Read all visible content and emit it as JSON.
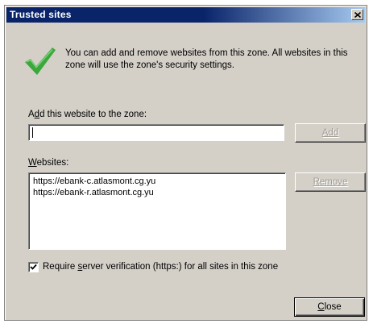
{
  "window": {
    "title": "Trusted sites",
    "close_glyph": "✕"
  },
  "info": {
    "icon": "check-icon",
    "text": "You can add and remove websites from this zone. All websites in this zone will use the zone's security settings."
  },
  "add_section": {
    "label_pre": "A",
    "label_mnemonic": "d",
    "label_post": "d this website to the zone:",
    "input_value": "",
    "add_button_label": "Add",
    "add_button_enabled": false
  },
  "websites_section": {
    "label_mnemonic": "W",
    "label_post": "ebsites:",
    "items": [
      "https://ebank-c.atlasmont.cg.yu",
      "https://ebank-r.atlasmont.cg.yu"
    ],
    "remove_button_label": "Remove",
    "remove_button_enabled": false
  },
  "verification": {
    "checked": true,
    "label_pre": "Require ",
    "label_mnemonic": "s",
    "label_post": "erver verification (https:) for all sites in this zone"
  },
  "footer": {
    "close_button_mnemonic": "C",
    "close_button_post": "lose"
  },
  "colors": {
    "dialog_face": "#d4d0c8",
    "titlebar_start": "#0a246a",
    "titlebar_end": "#a6caf0",
    "check_green": "#3aa83a"
  }
}
